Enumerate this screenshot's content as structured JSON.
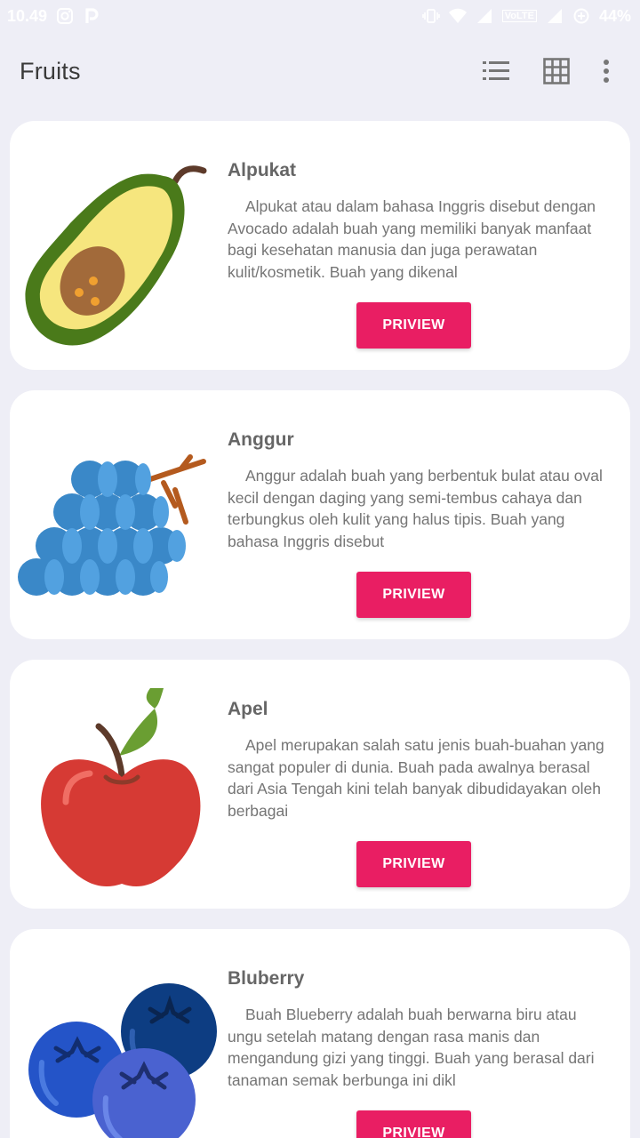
{
  "status_bar": {
    "time": "10.49",
    "network_label": "VoLTE",
    "battery": "44%",
    "icons": [
      "instagram-icon",
      "p-app-icon",
      "vibrate-icon",
      "wifi-icon",
      "signal-icon",
      "signal-icon-2",
      "data-saver-icon"
    ]
  },
  "app_bar": {
    "title": "Fruits",
    "actions": [
      "list-view-icon",
      "grid-view-icon",
      "more-vert-icon"
    ]
  },
  "colors": {
    "accent": "#e91e63",
    "background": "#eeeef6",
    "card": "#ffffff",
    "title_text": "#666666",
    "body_text": "#757575"
  },
  "fruits": [
    {
      "name": "Alpukat",
      "icon": "avocado-icon",
      "description": "Alpukat atau dalam bahasa Inggris disebut dengan Avocado adalah buah yang memiliki banyak manfaat bagi kesehatan manusia dan juga perawatan kulit/kosmetik. Buah yang dikenal",
      "button": "PRIVIEW"
    },
    {
      "name": "Anggur",
      "icon": "grapes-icon",
      "description": "Anggur adalah buah yang berbentuk bulat atau oval kecil dengan daging yang semi-tembus cahaya dan terbungkus oleh kulit yang halus tipis. Buah yang bahasa Inggris disebut",
      "button": "PRIVIEW"
    },
    {
      "name": "Apel",
      "icon": "apple-icon",
      "description": "Apel merupakan salah satu jenis buah-buahan yang sangat populer di dunia. Buah pada awalnya berasal dari Asia Tengah kini telah banyak dibudidayakan oleh berbagai",
      "button": "PRIVIEW"
    },
    {
      "name": "Bluberry",
      "icon": "blueberry-icon",
      "description": "Buah Blueberry adalah buah berwarna biru atau ungu setelah matang dengan rasa manis dan mengandung gizi yang tinggi. Buah yang berasal dari tanaman semak berbunga ini dikl",
      "button": "PRIVIEW"
    }
  ]
}
